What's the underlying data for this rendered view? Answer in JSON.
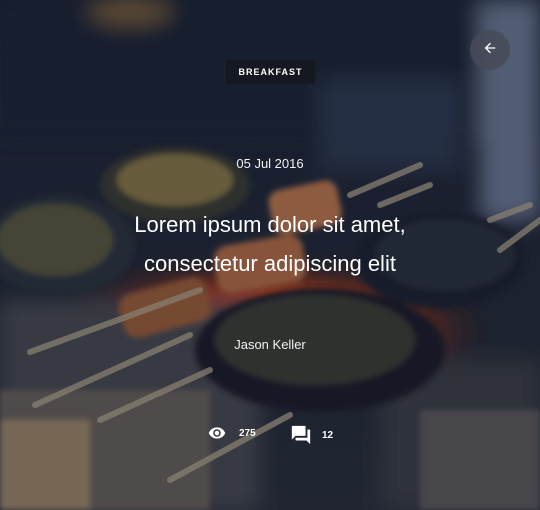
{
  "post": {
    "category": "BREAKFAST",
    "date": "05 Jul 2016",
    "title_line1": "Lorem ipsum dolor sit amet,",
    "title_line2": "consectetur adipiscing elit",
    "author": "Jason Keller"
  },
  "stats": {
    "views": "275",
    "comments": "12"
  },
  "icons": {
    "back": "arrow-left-icon",
    "views": "eye-icon",
    "comments": "comment-icon"
  },
  "colors": {
    "tag_bg": "#16181f",
    "back_button_bg": "#464a58",
    "text": "#ffffff"
  }
}
